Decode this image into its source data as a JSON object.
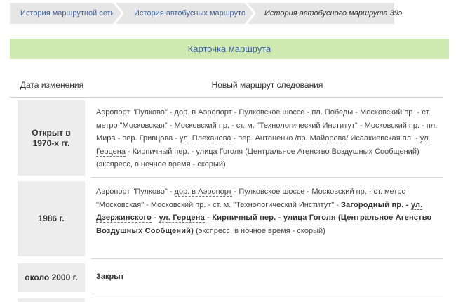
{
  "breadcrumb": {
    "items": [
      {
        "label": "История маршрутной сети"
      },
      {
        "label": "История автобусных маршрутов"
      },
      {
        "label": "История автобусного маршрута 39э"
      }
    ]
  },
  "card": {
    "title": "Карточка маршрута"
  },
  "table": {
    "col_date": "Дата изменения",
    "col_route": "Новый маршрут следования",
    "rows": [
      {
        "date": "Открыт в 1970-х гг.",
        "segments": [
          "Аэропорт \"Пулково\" - ",
          "дор. в Аэропорт",
          " - Пулковское шоссе - пл. Победы - Московский пр. - ст. метро \"Московская\" - Московский пр. - ст. м. \"Технологический Институт\" - Московский пр. - пл. Мира - пер. Гривцова - ",
          "ул. Плеханова",
          " - пер. Антоненко /",
          "пр. Майорова",
          "/ Исаакиевская пл. - ",
          "ул. Герцена",
          " - Кирпичный пер. - улица Гоголя (Центральное Агенство Воздушных Сообщений) (экспресс, в ночное время - скорый)"
        ]
      },
      {
        "date": "1986 г.",
        "segments": [
          "Аэропорт \"Пулково\" - ",
          "дор. в Аэропорт",
          " - Пулковское шоссе - Московский пр. - ст. метро \"Московская\" - Московский пр. - ст. м. \"Технологический Институт\" - ",
          "Загородный пр. - ",
          "ул. Дзержинского",
          " - ",
          "ул. Герцена",
          " - Кирпичный пер. - улица Гоголя (Центральное Агенство Воздушных Сообщений)",
          " (экспресс, в ночное время - скорый)"
        ]
      },
      {
        "date": "около 2000 г.",
        "text": "Закрыт"
      }
    ]
  }
}
